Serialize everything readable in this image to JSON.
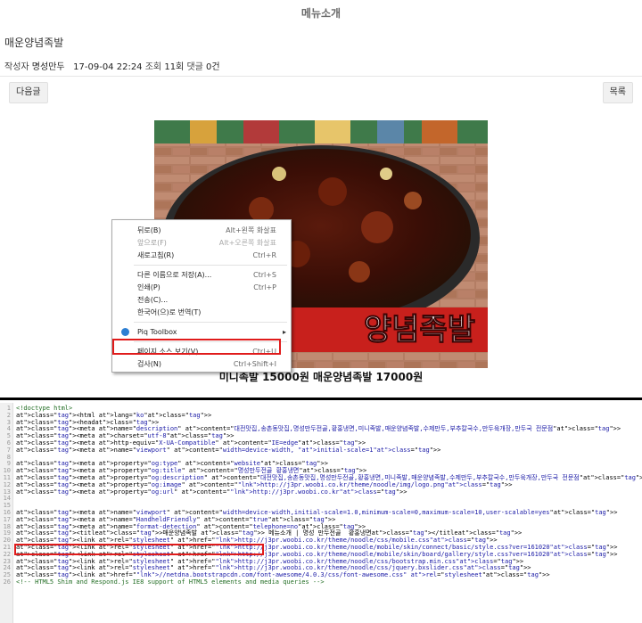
{
  "header": {
    "title": "메뉴소개"
  },
  "post": {
    "title": "매운양념족발",
    "author_label": "작성자",
    "author": "명성만두",
    "date": "17-09-04 22:24",
    "views_label": "조회",
    "views": "11회",
    "comments_label": "댓글",
    "comments": "0건"
  },
  "buttons": {
    "next": "다음글",
    "list": "목록"
  },
  "image": {
    "overlay_text": "양념족발"
  },
  "caption": "미니족발 15000원 매운양념족발 17000원",
  "context_menu": {
    "items": [
      {
        "label": "뒤로(B)",
        "shortcut": "Alt+왼쪽 화살표",
        "disabled": false
      },
      {
        "label": "앞으로(F)",
        "shortcut": "Alt+오른쪽 화살표",
        "disabled": true
      },
      {
        "label": "새로고침(R)",
        "shortcut": "Ctrl+R",
        "disabled": false
      },
      {
        "label": "다른 이름으로 저장(A)...",
        "shortcut": "Ctrl+S",
        "disabled": false
      },
      {
        "label": "인쇄(P)",
        "shortcut": "Ctrl+P",
        "disabled": false
      },
      {
        "label": "전송(C)...",
        "shortcut": "",
        "disabled": false
      },
      {
        "label": "한국어(으)로 번역(T)",
        "shortcut": "",
        "disabled": false
      },
      {
        "label": "Piq Toolbox",
        "shortcut": "▸",
        "disabled": false
      },
      {
        "label": "페이지 소스 보기(V)",
        "shortcut": "Ctrl+U",
        "disabled": false
      },
      {
        "label": "검사(N)",
        "shortcut": "Ctrl+Shift+I",
        "disabled": false
      }
    ]
  },
  "source_lines": [
    {
      "n": "1",
      "t": "<!doctype html>"
    },
    {
      "n": "2",
      "t": "<html lang=\"ko\">"
    },
    {
      "n": "3",
      "t": "<head>"
    },
    {
      "n": "4",
      "t": "<meta name=\"description\" content=\"대전맛집,송촌동맛집,명성만두전골,황홍냉면,미니족발,매운양념족발,수제만두,부추칼국수,만두육개장,만두국 전문점\">"
    },
    {
      "n": "5",
      "t": "<meta charset=\"utf-8\">"
    },
    {
      "n": "6",
      "t": "<meta http-equiv=\"X-UA-Compatible\" content=\"IE=edge\">"
    },
    {
      "n": "7",
      "t": "<meta name=\"viewport\" content=\"width=device-width, initial-scale=1\">"
    },
    {
      "n": "8",
      "t": ""
    },
    {
      "n": "9",
      "t": "<meta property=\"og:type\" content=\"website\">"
    },
    {
      "n": "10",
      "t": "<meta property=\"og:title\" content=\"명성만두전골 황홍냉면\">"
    },
    {
      "n": "11",
      "t": "<meta property=\"og:description\" content=\"대전맛집,송촌동맛집,명성만두전골,황홍냉면,미니족발,매운양념족발,수제만두,부추칼국수,만두육개장,만두국 전문점\">"
    },
    {
      "n": "12",
      "t": "<meta property=\"og:image\" content=\"http://j3pr.woobi.co.kr/theme/noodle/img/logo.png\">"
    },
    {
      "n": "13",
      "t": "<meta property=\"og:url\" content=\"http://j3pr.woobi.co.kr\">"
    },
    {
      "n": "14",
      "t": ""
    },
    {
      "n": "15",
      "t": ""
    },
    {
      "n": "16",
      "t": "<meta name=\"viewport\" content=\"width=device-width,initial-scale=1.0,minimum-scale=0,maximum-scale=10,user-scalable=yes\">"
    },
    {
      "n": "17",
      "t": "<meta name=\"HandheldFriendly\" content=\"true\">"
    },
    {
      "n": "18",
      "t": "<meta name=\"format-detection\" content=\"telephone=no\">"
    },
    {
      "n": "19",
      "t": "<title>매운양념족발 > 메뉴소개 | 명성 만두전골  황홍냉면</title>"
    },
    {
      "n": "20",
      "t": "<link rel=\"stylesheet\" href=\"http://j3pr.woobi.co.kr/theme/noodle/css/mobile.css\">"
    },
    {
      "n": "21",
      "t": "<link rel=\"stylesheet\" href=\"http://j3pr.woobi.co.kr/theme/noodle/mobile/skin/connect/basic/style.css?ver=161020\">"
    },
    {
      "n": "22",
      "t": "<link rel=\"stylesheet\" href=\"http://j3pr.woobi.co.kr/theme/noodle/mobile/skin/board/gallery/style.css?ver=161020\">"
    },
    {
      "n": "23",
      "t": "<link rel=\"stylesheet\" href=\"http://j3pr.woobi.co.kr/theme/noodle/css/bootstrap.min.css\">"
    },
    {
      "n": "24",
      "t": "<link rel=\"stylesheet\" href=\"http://j3pr.woobi.co.kr/theme/noodle/css/jquery.bxslider.css\">"
    },
    {
      "n": "25",
      "t": "<link href=\"//netdna.bootstrapcdn.com/font-awesome/4.0.3/css/font-awesome.css\" rel=\"stylesheet\">"
    },
    {
      "n": "26",
      "t": "<!-- HTML5 Shim and Respond.js IE8 support of HTML5 elements and media queries -->"
    }
  ]
}
